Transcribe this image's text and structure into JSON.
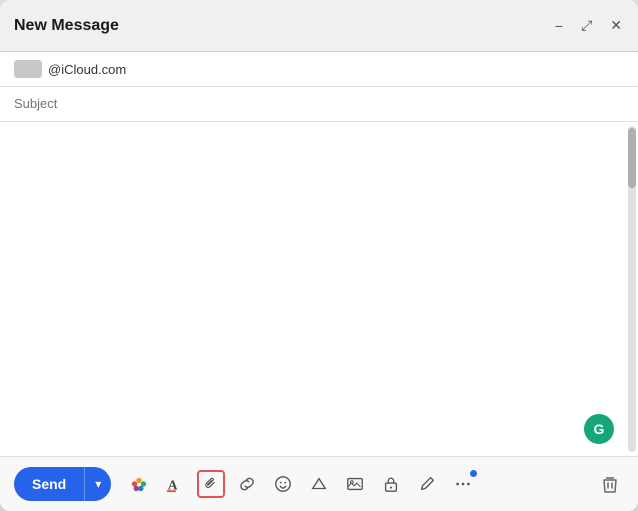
{
  "window": {
    "title": "New Message",
    "controls": {
      "minimize": "−",
      "expand": "⤢",
      "close": "✕"
    }
  },
  "compose": {
    "to_placeholder": "@iCloud.com",
    "to_value": "@iCloud.com",
    "subject_placeholder": "Subject",
    "body_cursor": "|"
  },
  "toolbar": {
    "send_label": "Send",
    "send_dropdown_icon": "▾",
    "tools": [
      {
        "name": "color-picker",
        "icon": "🎨"
      },
      {
        "name": "format-text",
        "icon": "A"
      },
      {
        "name": "attach-file",
        "icon": "📎"
      },
      {
        "name": "link",
        "icon": "🔗"
      },
      {
        "name": "emoji",
        "icon": "😊"
      },
      {
        "name": "triangle-shape",
        "icon": "△"
      },
      {
        "name": "image",
        "icon": "🖼"
      },
      {
        "name": "lock",
        "icon": "🔒"
      },
      {
        "name": "pen",
        "icon": "✏"
      },
      {
        "name": "more-options",
        "icon": "⋯"
      }
    ],
    "delete_icon": "🗑"
  },
  "grammarly": {
    "label": "G"
  }
}
